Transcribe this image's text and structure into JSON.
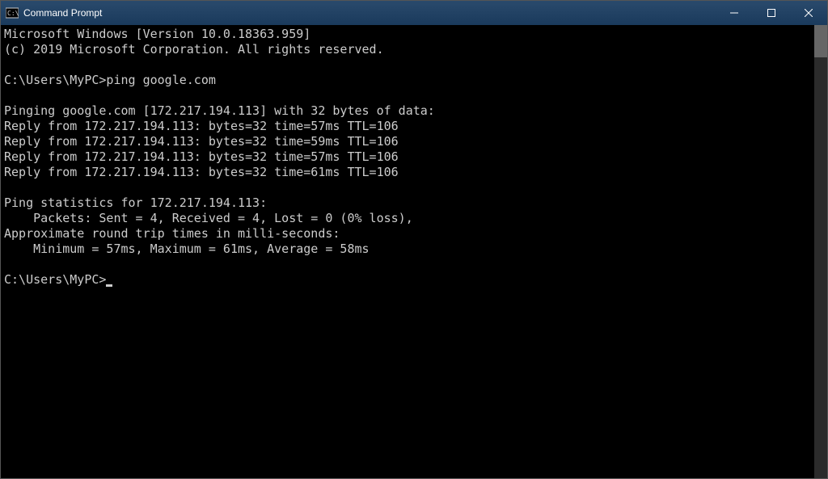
{
  "window": {
    "title": "Command Prompt"
  },
  "terminal": {
    "lines": [
      "Microsoft Windows [Version 10.0.18363.959]",
      "(c) 2019 Microsoft Corporation. All rights reserved.",
      "",
      "C:\\Users\\MyPC>ping google.com",
      "",
      "Pinging google.com [172.217.194.113] with 32 bytes of data:",
      "Reply from 172.217.194.113: bytes=32 time=57ms TTL=106",
      "Reply from 172.217.194.113: bytes=32 time=59ms TTL=106",
      "Reply from 172.217.194.113: bytes=32 time=57ms TTL=106",
      "Reply from 172.217.194.113: bytes=32 time=61ms TTL=106",
      "",
      "Ping statistics for 172.217.194.113:",
      "    Packets: Sent = 4, Received = 4, Lost = 0 (0% loss),",
      "Approximate round trip times in milli-seconds:",
      "    Minimum = 57ms, Maximum = 61ms, Average = 58ms",
      "",
      "C:\\Users\\MyPC>"
    ]
  }
}
